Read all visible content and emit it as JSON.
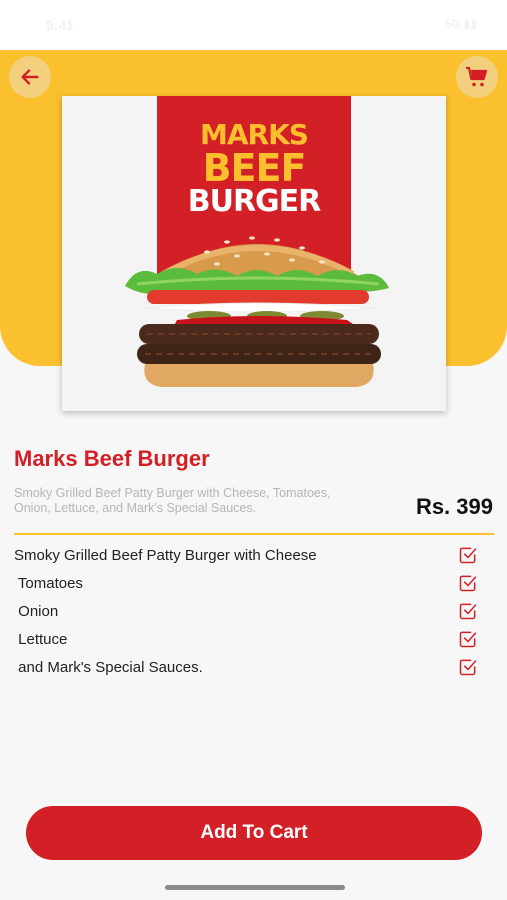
{
  "status_bar": {
    "time": "9:41",
    "indicators": "5G ▮▮"
  },
  "header": {
    "back_icon": "arrow-left-icon",
    "cart_icon": "shopping-cart-icon",
    "accent_color": "#fbc02d",
    "brand_color": "#d32027"
  },
  "product_image": {
    "line1": "MARKS",
    "line2": "BEEF",
    "line3": "BURGER"
  },
  "product": {
    "name": "Marks Beef Burger",
    "description": "Smoky Grilled Beef Patty Burger with Cheese, Tomatoes, Onion, Lettuce, and Mark's Special Sauces.",
    "price": "Rs. 399"
  },
  "ingredients": [
    {
      "label": "Smoky Grilled Beef Patty Burger with Cheese",
      "checked": true
    },
    {
      "label": " Tomatoes",
      "checked": true
    },
    {
      "label": " Onion",
      "checked": true
    },
    {
      "label": " Lettuce",
      "checked": true
    },
    {
      "label": " and Mark's Special Sauces.",
      "checked": true
    }
  ],
  "actions": {
    "add_to_cart_label": "Add To Cart"
  }
}
